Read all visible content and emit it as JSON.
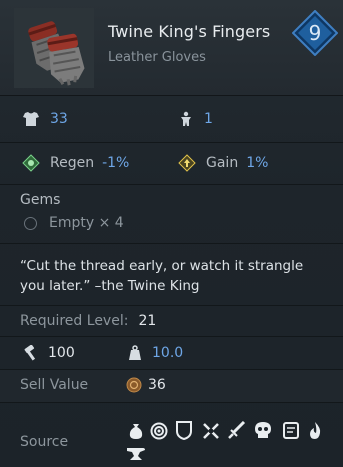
{
  "item": {
    "name": "Twine King's Fingers",
    "type": "Leather Gloves",
    "level_badge": "9"
  },
  "stats": {
    "armor": "33",
    "weight_class": "1",
    "regen_label": "Regen",
    "regen_value": "-1%",
    "gain_label": "Gain",
    "gain_value": "1%"
  },
  "gems": {
    "title": "Gems",
    "slots_text": "Empty × 4"
  },
  "flavor": {
    "quote": "“Cut the thread early, or watch it strangle you later.” –the Twine King"
  },
  "requirements": {
    "level_label": "Required Level:",
    "level_value": "21"
  },
  "durability": {
    "durability_value": "100",
    "weight_value": "10.0"
  },
  "sell": {
    "label": "Sell Value",
    "value": "36"
  },
  "source": {
    "label": "Source",
    "icons": [
      "pouch-icon",
      "target-icon",
      "shield-icon",
      "crossed-swords-icon",
      "sword-icon",
      "skull-icon",
      "scroll-icon",
      "flame-icon",
      "anvil-icon"
    ]
  },
  "colors": {
    "accent_blue": "#6ea6e6",
    "badge_blue": "#1f5f9e"
  }
}
